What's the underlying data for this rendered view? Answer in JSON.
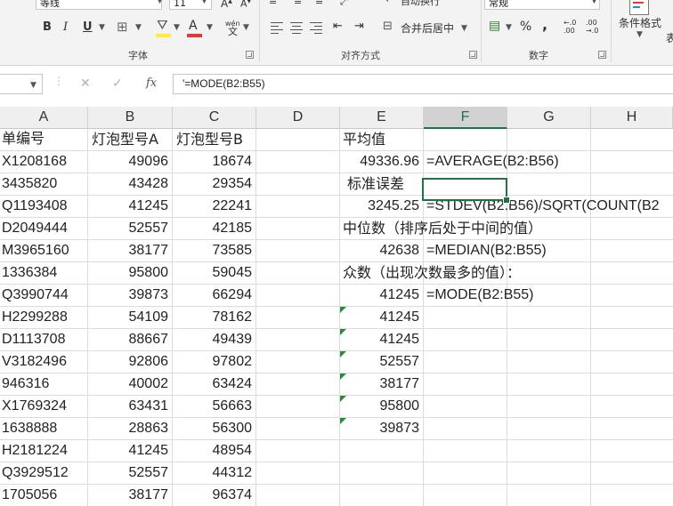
{
  "ribbon": {
    "font_name": "等线",
    "font_size": "11",
    "wrap_text_label": "自动换行",
    "number_format": "常规",
    "bold": "B",
    "italic": "I",
    "underline": "U",
    "font_color_glyph": "A",
    "wen_glyph": "wén",
    "wen_glyph2": "文",
    "merge_label": "合并后居中",
    "percent": "%",
    "comma": ",",
    "conditional_format": "条件格式",
    "table_format_partial": "表",
    "groups": {
      "font": "字体",
      "alignment": "对齐方式",
      "number": "数字"
    }
  },
  "formula_bar": {
    "cancel": "✕",
    "enter": "✓",
    "fx": "fx",
    "value": "'=MODE(B2:B55)"
  },
  "columns": [
    {
      "label": "A",
      "selected": false
    },
    {
      "label": "B",
      "selected": false
    },
    {
      "label": "C",
      "selected": false
    },
    {
      "label": "D",
      "selected": false
    },
    {
      "label": "E",
      "selected": false
    },
    {
      "label": "F",
      "selected": true
    },
    {
      "label": "G",
      "selected": false
    },
    {
      "label": "H",
      "selected": false
    }
  ],
  "col_a": [
    "单编号",
    "X1208168",
    "3435820",
    "Q1193408",
    "D2049444",
    "M3965160",
    "1336384",
    "Q3990744",
    "H2299288",
    "D1113708",
    "V3182496",
    "946316",
    "X1769324",
    "1638888",
    "H2181224",
    "Q3929512",
    "1705056"
  ],
  "col_b": [
    "灯泡型号A",
    "49096",
    "43428",
    "41245",
    "52557",
    "38177",
    "95800",
    "39873",
    "54109",
    "88667",
    "92806",
    "40002",
    "63431",
    "28863",
    "41245",
    "52557",
    "38177"
  ],
  "col_c": [
    "灯泡型号B",
    "18674",
    "29354",
    "22241",
    "42185",
    "73585",
    "59045",
    "66294",
    "78162",
    "49439",
    "97802",
    "63424",
    "56663",
    "56300",
    "48954",
    "44312",
    "96374"
  ],
  "stats": {
    "mean_label": "平均值",
    "mean_value": "49336.96",
    "mean_formula": "=AVERAGE(B2:B56)",
    "se_label": "标准误差",
    "se_value": "3245.25",
    "se_formula": "=STDEV(B2:B56)/SQRT(COUNT(B2",
    "median_label": "中位数（排序后处于中间的值）",
    "median_value": "42638",
    "median_formula": "=MEDIAN(B2:B55)",
    "mode_label": "众数（出现次数最多的值）：",
    "mode_value": "41245",
    "mode_formula": "=MODE(B2:B55)"
  },
  "text_numbers": [
    "41245",
    "41245",
    "52557",
    "38177",
    "95800",
    "39873"
  ],
  "colors": {
    "accent": "#217346",
    "error_marker": "#2a8a3a",
    "header_bg": "#efefef",
    "ribbon_bg": "#f3f3f3"
  }
}
